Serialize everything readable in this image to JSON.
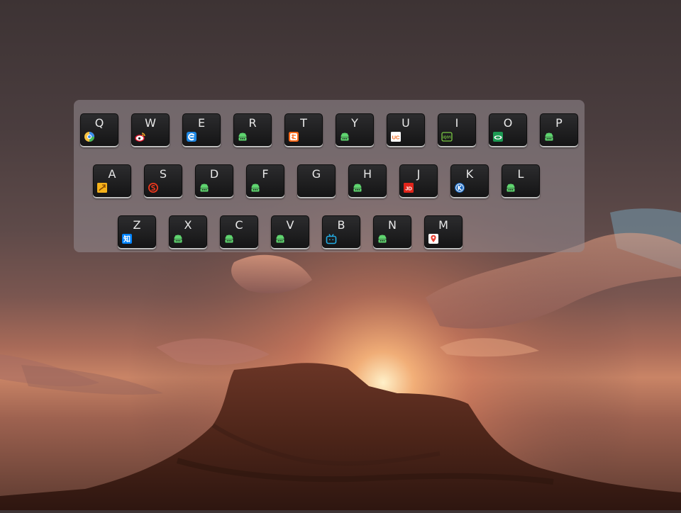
{
  "rows": [
    [
      {
        "letter": "Q",
        "icon": "browser-orb-icon"
      },
      {
        "letter": "W",
        "icon": "weibo-icon"
      },
      {
        "letter": "E",
        "icon": "blue-e-icon"
      },
      {
        "letter": "R",
        "icon": "android-icon"
      },
      {
        "letter": "T",
        "icon": "taobao-icon"
      },
      {
        "letter": "Y",
        "icon": "android-icon"
      },
      {
        "letter": "U",
        "icon": "uc-browser-icon"
      },
      {
        "letter": "I",
        "icon": "iqiyi-icon"
      },
      {
        "letter": "O",
        "icon": "green-eye-icon"
      },
      {
        "letter": "P",
        "icon": "android-icon"
      }
    ],
    [
      {
        "letter": "A",
        "icon": "yellow-flag-icon"
      },
      {
        "letter": "S",
        "icon": "sogou-icon"
      },
      {
        "letter": "D",
        "icon": "android-icon"
      },
      {
        "letter": "F",
        "icon": "android-icon"
      },
      {
        "letter": "G",
        "icon": ""
      },
      {
        "letter": "H",
        "icon": "android-icon"
      },
      {
        "letter": "J",
        "icon": "jd-icon"
      },
      {
        "letter": "K",
        "icon": "blue-k-icon"
      },
      {
        "letter": "L",
        "icon": "android-icon"
      }
    ],
    [
      {
        "letter": "Z",
        "icon": "zhihu-icon"
      },
      {
        "letter": "X",
        "icon": "android-icon"
      },
      {
        "letter": "C",
        "icon": "android-icon"
      },
      {
        "letter": "V",
        "icon": "android-icon"
      },
      {
        "letter": "B",
        "icon": "bilibili-icon"
      },
      {
        "letter": "N",
        "icon": "android-icon"
      },
      {
        "letter": "M",
        "icon": "map-pin-icon"
      }
    ]
  ],
  "icon_text": {
    "zhihu": "知",
    "jd": "JD",
    "uc": "UC",
    "iqiyi": "iQIYI"
  }
}
